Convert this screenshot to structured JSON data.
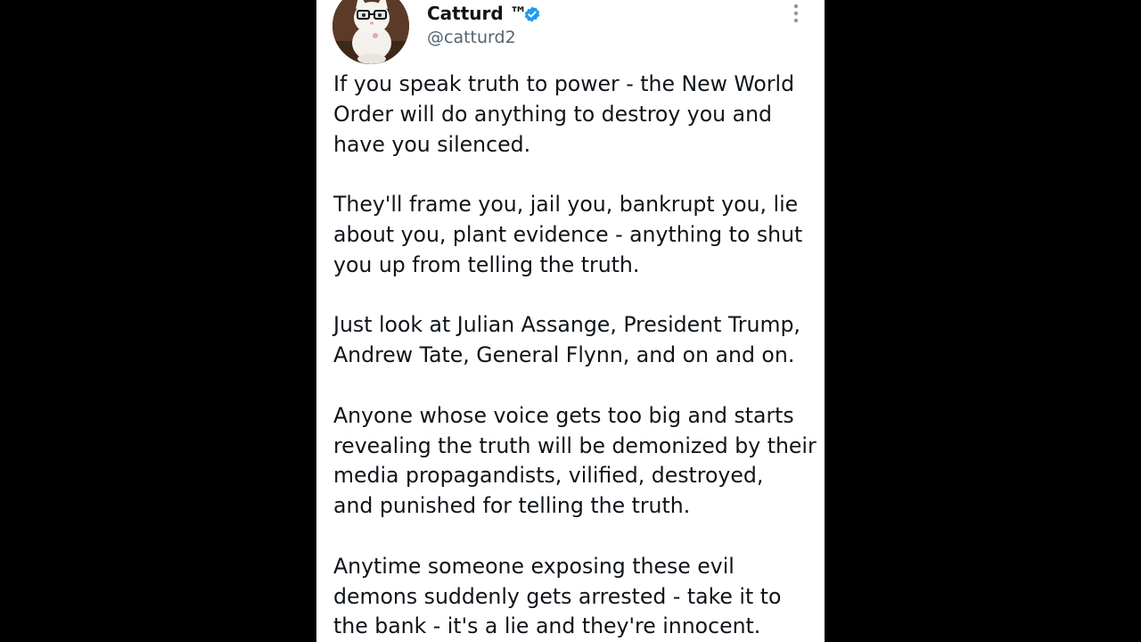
{
  "author": {
    "display_name": "Catturd ™",
    "handle": "@catturd2",
    "verified": true,
    "avatar_icon": "cat-with-glasses-avatar"
  },
  "colors": {
    "page_background": "#000000",
    "card_background": "#ffffff",
    "text_primary": "#0f1419",
    "text_secondary": "#536471",
    "verified_blue": "#1d9bf0",
    "more_icon": "#8b98a5"
  },
  "icons": {
    "verified": "verified-badge-icon",
    "more": "more-options-icon"
  },
  "tweet": {
    "paragraphs": [
      {
        "lines": [
          "If you speak truth to power  - the New World",
          "Order will do anything to destroy you and",
          "have you silenced."
        ]
      },
      {
        "lines": [
          "They'll frame you, jail you, bankrupt you, lie",
          "about you, plant evidence - anything to shut",
          "you up from telling the truth."
        ]
      },
      {
        "lines": [
          "Just look at Julian Assange, President Trump,",
          "Andrew Tate, General Flynn, and on and on."
        ]
      },
      {
        "lines": [
          "Anyone whose voice gets too big and starts",
          "revealing the truth will be demonized by their",
          "media propagandists, vilified, destroyed,",
          "and punished for telling the truth."
        ]
      },
      {
        "lines": [
          "Anytime someone exposing these evil",
          "demons suddenly gets arrested - take it to",
          "the bank - it's a lie and they're innocent."
        ]
      }
    ]
  }
}
